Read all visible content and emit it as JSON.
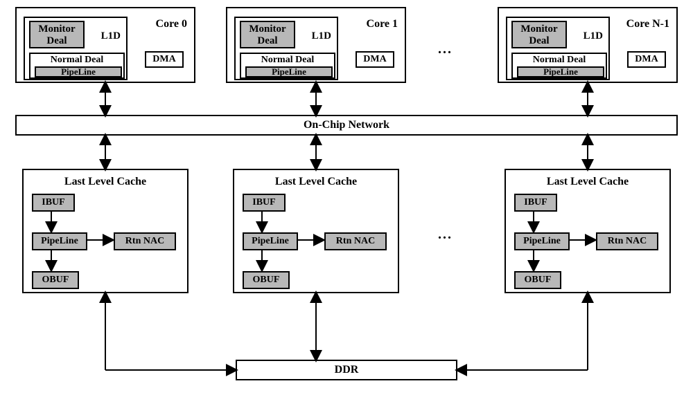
{
  "cores": [
    {
      "title": "Core 0",
      "monitor": "Monitor\nDeal",
      "l1d": "L1D",
      "normal": "Normal Deal",
      "pipeline": "PipeLine",
      "dma": "DMA"
    },
    {
      "title": "Core 1",
      "monitor": "Monitor\nDeal",
      "l1d": "L1D",
      "normal": "Normal Deal",
      "pipeline": "PipeLine",
      "dma": "DMA"
    },
    {
      "title": "Core N-1",
      "monitor": "Monitor\nDeal",
      "l1d": "L1D",
      "normal": "Normal Deal",
      "pipeline": "PipeLine",
      "dma": "DMA"
    }
  ],
  "ocn": "On-Chip Network",
  "llc": [
    {
      "title": "Last Level Cache",
      "ibuf": "IBUF",
      "pipeline": "PipeLine",
      "rtn": "Rtn NAC",
      "obuf": "OBUF"
    },
    {
      "title": "Last Level Cache",
      "ibuf": "IBUF",
      "pipeline": "PipeLine",
      "rtn": "Rtn NAC",
      "obuf": "OBUF"
    },
    {
      "title": "Last Level Cache",
      "ibuf": "IBUF",
      "pipeline": "PipeLine",
      "rtn": "Rtn NAC",
      "obuf": "OBUF"
    }
  ],
  "ddr": "DDR",
  "ellipsis": "..."
}
